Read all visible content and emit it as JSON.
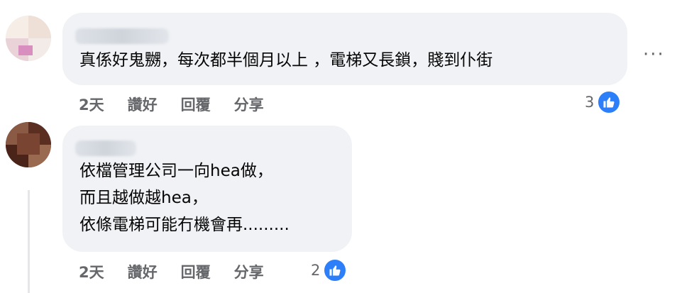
{
  "comments": [
    {
      "text": "真係好鬼嬲，每次都半個月以上 ，電梯又長鎖，賤到仆街",
      "time": "2天",
      "like_label": "讚好",
      "reply_label": "回覆",
      "share_label": "分享",
      "reaction_count": "3"
    },
    {
      "text": "依檔管理公司一向hea做，\n而且越做越hea，\n依條電梯可能冇機會再.........",
      "time": "2天",
      "like_label": "讚好",
      "reply_label": "回覆",
      "share_label": "分享",
      "reaction_count": "2"
    }
  ],
  "more_options": "···",
  "colors": {
    "bubble": "#f0f2f5",
    "secondary_text": "#65676b",
    "like_blue": "#2d7ff9"
  },
  "icons": [
    "more-options-icon",
    "thumbs-up-icon"
  ]
}
